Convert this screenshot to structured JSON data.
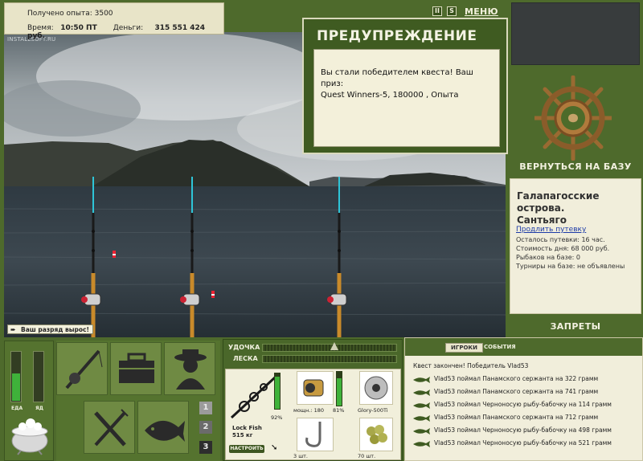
{
  "top": {
    "xp_label": "Получено опыта:",
    "xp_value": "3500",
    "time_label": "Время:",
    "time_value": "10:50 ПТ",
    "money_label": "Деньги:",
    "money_value": "315 551 424 руб."
  },
  "watermark": "INSTALLSOFT.RU",
  "controls": {
    "pause": "II",
    "sound": "S",
    "menu": "МЕНЮ"
  },
  "warning": {
    "title": "ПРЕДУПРЕЖДЕНИЕ",
    "line1": "Вы стали победителем квеста! Ваш приз:",
    "line2": "Quest Winners-5, 180000 , Опыта"
  },
  "right": {
    "return_base": "ВЕРНУТЬСЯ НА БАЗУ",
    "location_line1": "Галапагосские острова.",
    "location_line2": "Сантьяго",
    "extend_link": "Продлить путевку",
    "info": [
      "Осталось путевки: 16 час.",
      "Стоимость дня: 68 000 руб.",
      "Рыбаков на базе: 0",
      "Турниры на базе: не объявлены"
    ],
    "bans": "ЗАПРЕТЫ"
  },
  "toast": "Ваш разряд вырос!",
  "gauges": {
    "food_label": "ЕДА",
    "poison_label": "ЯД",
    "food_fill": 0.55,
    "poison_fill": 0.0,
    "colors": {
      "food": "#3fb23a",
      "poison": "#5a6a3a"
    }
  },
  "page_numbers": [
    "1",
    "2",
    "3"
  ],
  "tackle": {
    "rod_label": "УДОЧКА",
    "line_label": "ЛЕСКА",
    "rod_name": "Lock Fish",
    "rod_weight": "515 кг",
    "rod_percent": "92%",
    "reel_power": "мощн.: 180",
    "reel_percent": "81%",
    "line_name": "Glory-500Ti",
    "hooks_qty": "3 шт.",
    "bait_qty": "70 шт.",
    "setup_button": "НАСТРОИТЬ"
  },
  "log": {
    "tab_players": "ИГРОКИ",
    "tab_events": "СОБЫТИЯ",
    "header": "Квест закончен! Победитель Vlad53",
    "rows": [
      "Vlad53 поймал Панамского сержанта на 322 грамм",
      "Vlad53 поймал Панамского сержанта на 741 грамм",
      "Vlad53 поймал Черноносую рыбу-бабочку на 114 грамм",
      "Vlad53 поймал Панамского сержанта на 712 грамм",
      "Vlad53 поймал Черноносую рыбу-бабочку на 498 грамм",
      "Vlad53 поймал Черноносую рыбу-бабочку на 521 грамм"
    ]
  }
}
